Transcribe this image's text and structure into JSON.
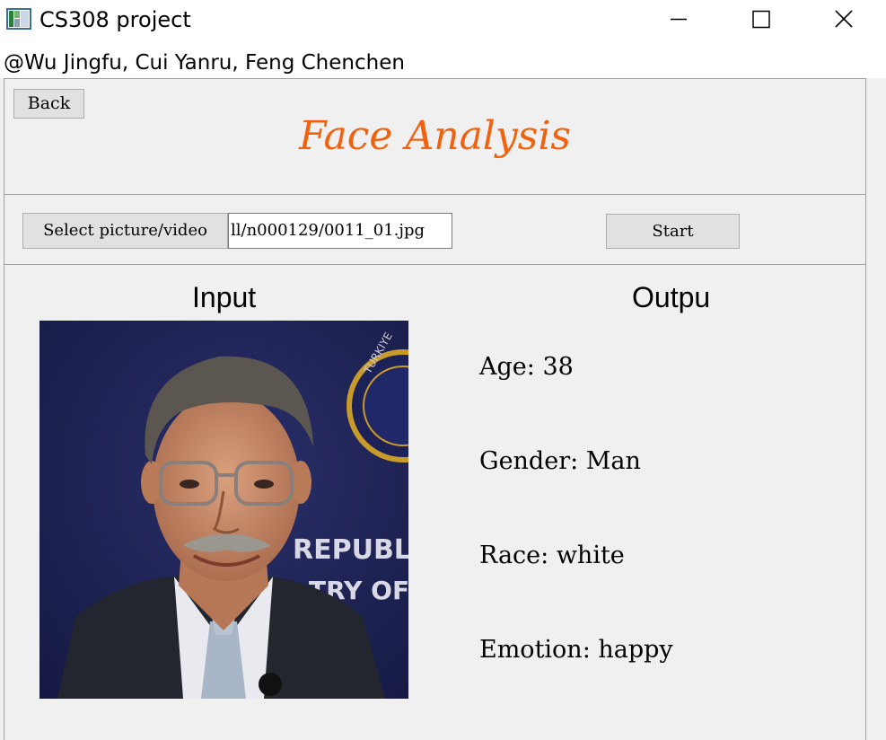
{
  "window": {
    "title": "CS308 project",
    "controls": [
      "minimize",
      "maximize",
      "close"
    ]
  },
  "authors": "@Wu Jingfu, Cui Yanru, Feng Chenchen",
  "header": {
    "back_label": "Back",
    "title": "Face Analysis",
    "title_color": "#f0620e"
  },
  "toolbar": {
    "select_label": "Select picture/video",
    "path_value": "ll/n000129/0011_01.jpg",
    "start_label": "Start"
  },
  "content": {
    "input_heading": "Input",
    "output_heading": "Outpu",
    "image": {
      "background_text_1": "REPUBL",
      "background_text_2": "TRY OF",
      "seal_text": "TURKIYE"
    },
    "results": {
      "age": "Age: 38",
      "gender": "Gender: Man",
      "race": "Race: white",
      "emotion": "Emotion: happy"
    }
  }
}
